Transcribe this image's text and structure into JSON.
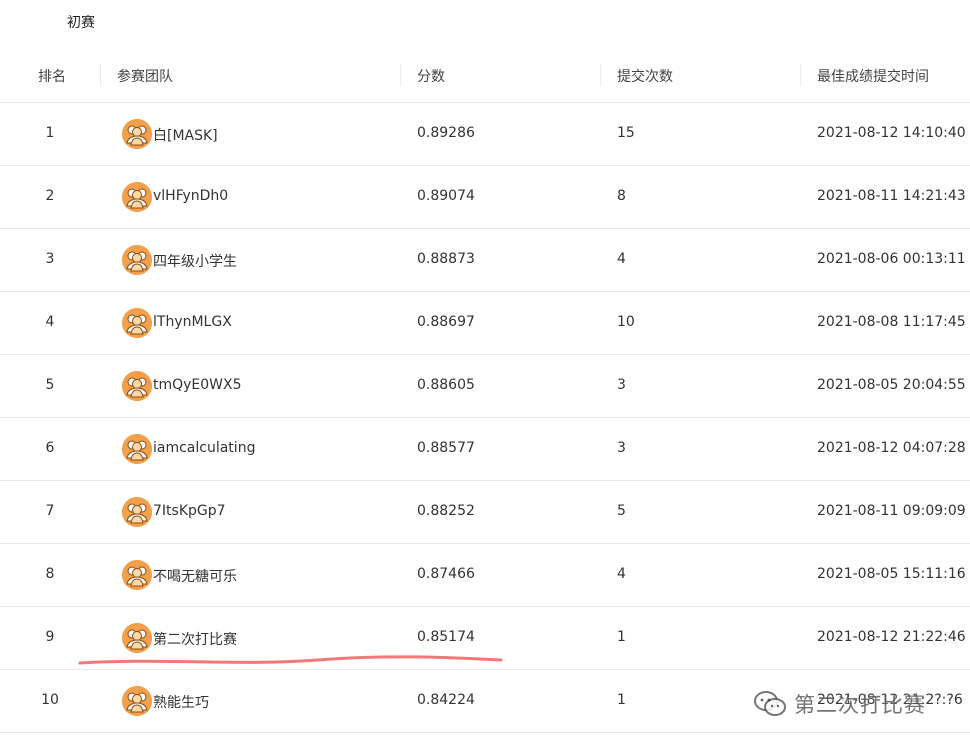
{
  "stage_tab": "初赛",
  "columns": {
    "rank": "排名",
    "team": "参赛团队",
    "score": "分数",
    "submissions": "提交次数",
    "best_time": "最佳成绩提交时间"
  },
  "rows": [
    {
      "rank": "1",
      "team": "白[MASK]",
      "score": "0.89286",
      "submissions": "15",
      "best_time": "2021-08-12 14:10:40"
    },
    {
      "rank": "2",
      "team": "vlHFynDh0",
      "score": "0.89074",
      "submissions": "8",
      "best_time": "2021-08-11 14:21:43"
    },
    {
      "rank": "3",
      "team": "四年级小学生",
      "score": "0.88873",
      "submissions": "4",
      "best_time": "2021-08-06 00:13:11"
    },
    {
      "rank": "4",
      "team": "lThynMLGX",
      "score": "0.88697",
      "submissions": "10",
      "best_time": "2021-08-08 11:17:45"
    },
    {
      "rank": "5",
      "team": "tmQyE0WX5",
      "score": "0.88605",
      "submissions": "3",
      "best_time": "2021-08-05 20:04:55"
    },
    {
      "rank": "6",
      "team": "iamcalculating",
      "score": "0.88577",
      "submissions": "3",
      "best_time": "2021-08-12 04:07:28"
    },
    {
      "rank": "7",
      "team": "7ItsKpGp7",
      "score": "0.88252",
      "submissions": "5",
      "best_time": "2021-08-11 09:09:09"
    },
    {
      "rank": "8",
      "team": "不喝无糖可乐",
      "score": "0.87466",
      "submissions": "4",
      "best_time": "2021-08-05 15:11:16"
    },
    {
      "rank": "9",
      "team": "第二次打比赛",
      "score": "0.85174",
      "submissions": "1",
      "best_time": "2021-08-12 21:22:46"
    },
    {
      "rank": "10",
      "team": "熟能生巧",
      "score": "0.84224",
      "submissions": "1",
      "best_time": "2021-08-12 21:2?:?6"
    }
  ],
  "watermark": {
    "text": "第二次打比赛",
    "icon": "wechat-icon"
  },
  "colors": {
    "avatar": "#f2a04c",
    "highlight_stroke": "#f07a7a",
    "divider": "#e8e8e8"
  }
}
